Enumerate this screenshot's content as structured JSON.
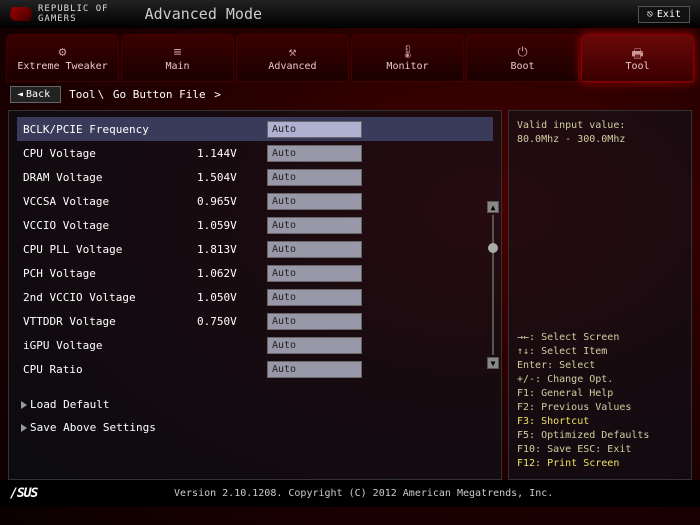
{
  "header": {
    "brand_line1": "REPUBLIC OF",
    "brand_line2": "GAMERS",
    "mode": "Advanced Mode",
    "exit": "Exit"
  },
  "tabs": [
    {
      "label": "Extreme Tweaker",
      "active": false
    },
    {
      "label": "Main",
      "active": false
    },
    {
      "label": "Advanced",
      "active": false
    },
    {
      "label": "Monitor",
      "active": false
    },
    {
      "label": "Boot",
      "active": false
    },
    {
      "label": "Tool",
      "active": true
    }
  ],
  "breadcrumb": {
    "back": "Back",
    "root": "Tool",
    "current": "Go Button File"
  },
  "settings": [
    {
      "label": "BCLK/PCIE Frequency",
      "value": "",
      "field": "Auto",
      "selected": true
    },
    {
      "label": "CPU Voltage",
      "value": "1.144V",
      "field": "Auto",
      "selected": false
    },
    {
      "label": "DRAM Voltage",
      "value": "1.504V",
      "field": "Auto",
      "selected": false
    },
    {
      "label": "VCCSA Voltage",
      "value": "0.965V",
      "field": "Auto",
      "selected": false
    },
    {
      "label": "VCCIO Voltage",
      "value": "1.059V",
      "field": "Auto",
      "selected": false
    },
    {
      "label": "CPU PLL Voltage",
      "value": "1.813V",
      "field": "Auto",
      "selected": false
    },
    {
      "label": "PCH Voltage",
      "value": "1.062V",
      "field": "Auto",
      "selected": false
    },
    {
      "label": "2nd VCCIO Voltage",
      "value": "1.050V",
      "field": "Auto",
      "selected": false
    },
    {
      "label": "VTTDDR Voltage",
      "value": "0.750V",
      "field": "Auto",
      "selected": false
    },
    {
      "label": "iGPU Voltage",
      "value": "",
      "field": "Auto",
      "selected": false
    },
    {
      "label": "CPU Ratio",
      "value": "",
      "field": "Auto",
      "selected": false
    }
  ],
  "actions": {
    "load_default": "Load Default",
    "save_above": "Save Above Settings"
  },
  "help": {
    "valid_label": "Valid input value:",
    "valid_range": "80.0Mhz - 300.0Mhz",
    "keys": [
      {
        "text": "→←: Select Screen",
        "hl": false
      },
      {
        "text": "↑↓: Select Item",
        "hl": false
      },
      {
        "text": "Enter: Select",
        "hl": false
      },
      {
        "text": "+/-: Change Opt.",
        "hl": false
      },
      {
        "text": "F1: General Help",
        "hl": false
      },
      {
        "text": "F2: Previous Values",
        "hl": false
      },
      {
        "text": "F3: Shortcut",
        "hl": true
      },
      {
        "text": "F5: Optimized Defaults",
        "hl": false
      },
      {
        "text": "F10: Save  ESC: Exit",
        "hl": false
      },
      {
        "text": "F12: Print Screen",
        "hl": true
      }
    ]
  },
  "footer": {
    "vendor": "/SUS",
    "text": "Version 2.10.1208. Copyright (C) 2012 American Megatrends, Inc."
  }
}
